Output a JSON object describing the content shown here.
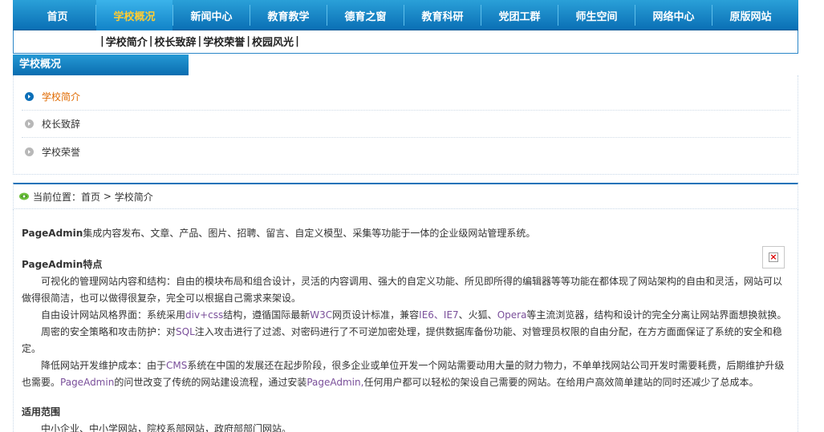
{
  "topnav": {
    "items": [
      "首页",
      "学校概况",
      "新闻中心",
      "教育教学",
      "德育之窗",
      "教育科研",
      "党团工群",
      "师生空间",
      "网络中心",
      "原版网站"
    ],
    "active_index": 1
  },
  "subnav": {
    "items": [
      "学校简介",
      "校长致辞",
      "学校荣誉",
      "校园风光"
    ],
    "separator": "|"
  },
  "sidebar": {
    "title": "学校概况",
    "items": [
      {
        "label": "学校简介",
        "active": true
      },
      {
        "label": "校长致辞",
        "active": false
      },
      {
        "label": "学校荣誉",
        "active": false
      }
    ]
  },
  "breadcrumb": {
    "prefix": "当前位置：",
    "home": "首页",
    "arrow": " > ",
    "current": "学校简介"
  },
  "content": {
    "intro_brand": "PageAdmin",
    "intro_text": "集成内容发布、文章、产品、图片、招聘、留言、自定义模型、采集等功能于一体的企业级网站管理系统。",
    "features_title": "PageAdmin特点",
    "para1": "可视化的管理网站内容和结构：自由的模块布局和组合设计，灵活的内容调用、强大的自定义功能、所见即所得的编辑器等等功能在都体现了网站架构的自由和灵活，网站可以做得很简洁，也可以做得很复杂，完全可以根据自己需求来架设。",
    "para2_a": "自由设计网站风格界面：系统采用",
    "para2_b": "div+css",
    "para2_c": "结构，遵循国际最新",
    "para2_d": "W3C",
    "para2_e": "网页设计标准，兼容",
    "para2_f": "IE6、IE7",
    "para2_g": "、火狐、",
    "para2_h": "Opera",
    "para2_i": "等主流浏览器，结构和设计的完全分离让网站界面想换就换。",
    "para3_a": "周密的安全策略和攻击防护：对",
    "para3_b": "SQL",
    "para3_c": "注入攻击进行了过滤、对密码进行了不可逆加密处理，提供数据库备份功能、对管理员权限的自由分配，在方方面面保证了系统的安全和稳定。",
    "para4_a": "降低网站开发维护成本：由于",
    "para4_b": "CMS",
    "para4_c": "系统在中国的发展还在起步阶段，很多企业或单位开发一个网站需要动用大量的财力物力，不单单找网站公司开发时需要耗费，后期维护升级也需要。",
    "para4_d": "PageAdmin",
    "para4_e": "的问世改变了传统的网站建设流程，通过安装",
    "para4_f": "PageAdmin,",
    "para4_g": "任何用户都可以轻松的架设自己需要的网站。在给用户高效简单建站的同时还减少了总成本。",
    "scope_title": "适用范围",
    "scope_text": "中小企业、中小学网站，院校系部网站，政府部部门网站。"
  },
  "colors": {
    "nav_blue": "#0a6fb5",
    "nav_active_text": "#ffcc33",
    "side_active_text": "#e06a00",
    "accent_purple": "#7a4f9a"
  }
}
